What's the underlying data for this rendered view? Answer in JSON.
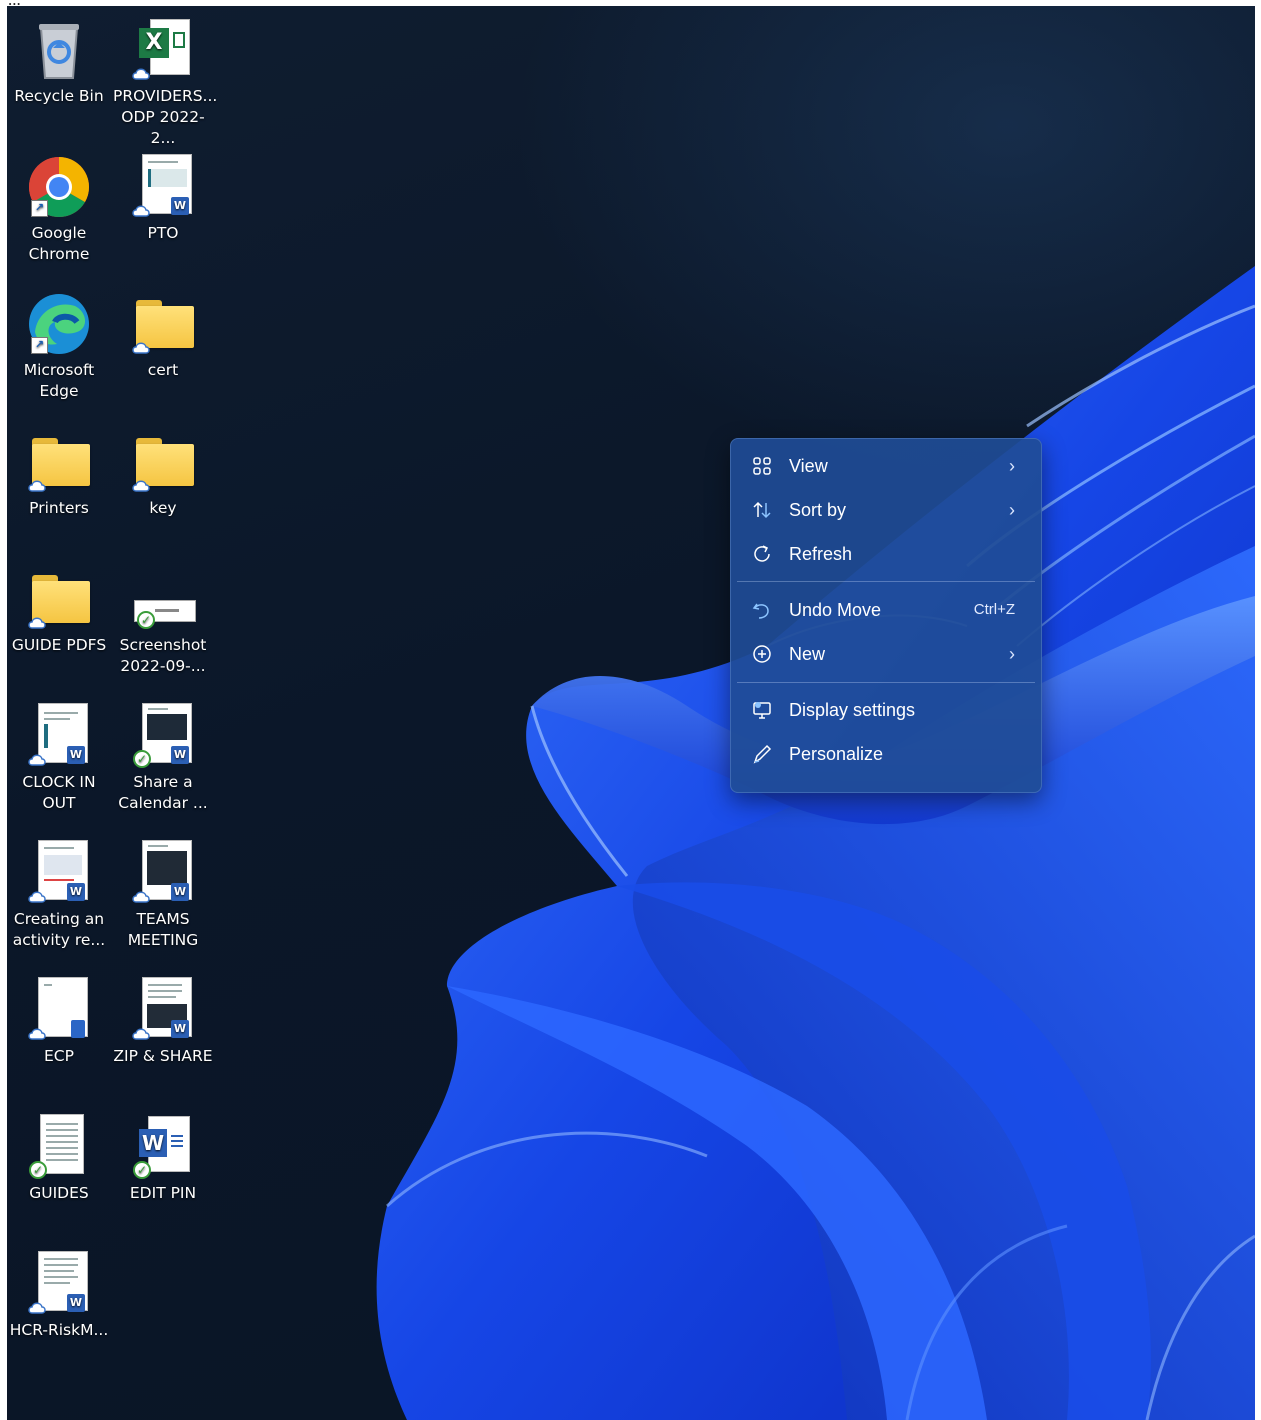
{
  "doc_text": "...",
  "desktop": {
    "icons": [
      {
        "label": "Recycle Bin",
        "icon": "recycle-bin-icon"
      },
      {
        "label": "PROVIDERS... ODP 2022-2...",
        "icon": "excel-file-icon"
      },
      {
        "label": "Google Chrome",
        "icon": "chrome-icon"
      },
      {
        "label": "PTO",
        "icon": "word-document-icon"
      },
      {
        "label": "Microsoft Edge",
        "icon": "edge-icon"
      },
      {
        "label": "cert",
        "icon": "folder-icon"
      },
      {
        "label": "Printers",
        "icon": "folder-icon"
      },
      {
        "label": "key",
        "icon": "folder-icon"
      },
      {
        "label": "GUIDE PDFS",
        "icon": "folder-icon"
      },
      {
        "label": "Screenshot 2022-09-...",
        "icon": "image-file-icon"
      },
      {
        "label": "CLOCK IN OUT",
        "icon": "word-document-icon"
      },
      {
        "label": "Share a Calendar ...",
        "icon": "word-document-icon"
      },
      {
        "label": "Creating an activity re...",
        "icon": "word-document-icon"
      },
      {
        "label": "TEAMS MEETING",
        "icon": "word-document-icon"
      },
      {
        "label": "ECP",
        "icon": "text-file-icon"
      },
      {
        "label": "ZIP & SHARE",
        "icon": "word-document-icon"
      },
      {
        "label": "GUIDES",
        "icon": "text-file-icon"
      },
      {
        "label": "EDIT PIN",
        "icon": "word-file-icon"
      },
      {
        "label": "HCR-RiskM...",
        "icon": "word-document-icon"
      }
    ]
  },
  "context_menu": {
    "items": [
      {
        "label": "View",
        "icon": "view-grid-icon",
        "submenu": true
      },
      {
        "label": "Sort by",
        "icon": "sort-icon",
        "submenu": true
      },
      {
        "label": "Refresh",
        "icon": "refresh-icon"
      },
      {
        "label": "Undo Move",
        "icon": "undo-icon",
        "shortcut": "Ctrl+Z"
      },
      {
        "label": "New",
        "icon": "new-plus-icon",
        "submenu": true
      },
      {
        "label": "Display settings",
        "icon": "display-settings-icon"
      },
      {
        "label": "Personalize",
        "icon": "personalize-pen-icon"
      }
    ],
    "arrow_glyph": "›"
  },
  "colors": {
    "menu_bg": "#1f4c96",
    "wallpaper_blue": "#1f5fff",
    "desktop_bg": "#0b1729"
  }
}
